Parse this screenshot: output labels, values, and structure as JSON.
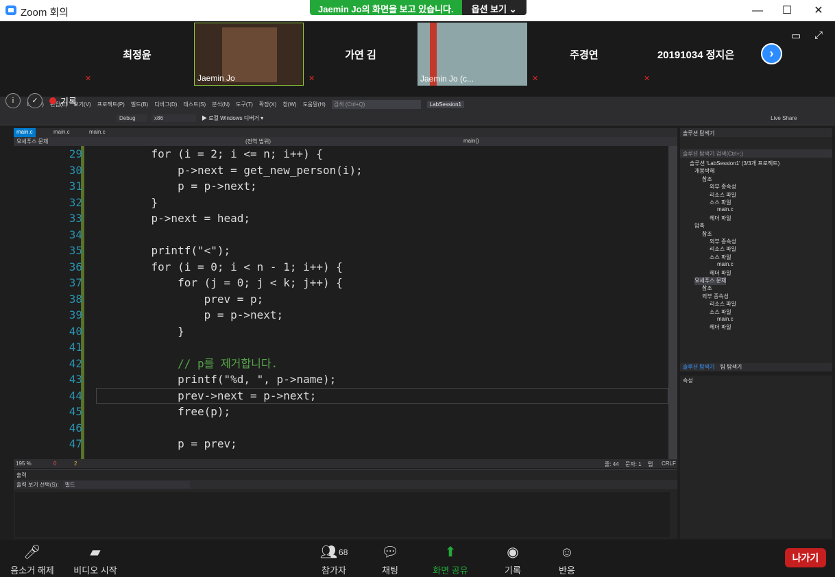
{
  "window": {
    "title": "Zoom 회의",
    "minimize": "—",
    "maximize": "☐",
    "close": "✕"
  },
  "share_banner": {
    "message": "Jaemin Jo의 화면을 보고 있습니다.",
    "options": "옵션 보기 ⌄"
  },
  "gallery": {
    "tiles": [
      {
        "name": "최정윤",
        "video": false
      },
      {
        "name": "Jaemin Jo",
        "video": true
      },
      {
        "name": "가연 김",
        "video": false
      },
      {
        "name": "Jaemin Jo (c...",
        "video": true
      },
      {
        "name": "주경연",
        "video": false
      },
      {
        "name": "20191034 정지은",
        "video": false
      }
    ],
    "next": "›"
  },
  "recording": {
    "label": "기록",
    "info": "i",
    "shield": "✓"
  },
  "vs": {
    "menu": [
      "파일(F)",
      "편집(E)",
      "보기(V)",
      "프로젝트(P)",
      "빌드(B)",
      "디버그(D)",
      "테스트(S)",
      "분석(N)",
      "도구(T)",
      "확장(X)",
      "창(W)",
      "도움말(H)"
    ],
    "search_placeholder": "검색 (Ctrl+Q)",
    "solution_name": "LabSession1",
    "live_share": "Live Share",
    "toolbar": {
      "config": "Debug",
      "platform": "x86",
      "run": "▶ 로컬 Windows 디버거 ▾"
    },
    "tabs": [
      "main.c",
      "main.c",
      "main.c"
    ],
    "nav": {
      "project": "요세푸스 문제",
      "scope": "(전역 범위)",
      "func": "main()"
    },
    "code": [
      {
        "n": "29",
        "t": "    for (i = 2; i <= n; i++) {"
      },
      {
        "n": "30",
        "t": "        p->next = get_new_person(i);"
      },
      {
        "n": "31",
        "t": "        p = p->next;"
      },
      {
        "n": "32",
        "t": "    }"
      },
      {
        "n": "33",
        "t": "    p->next = head;"
      },
      {
        "n": "34",
        "t": ""
      },
      {
        "n": "35",
        "t": "    printf(\"<\");"
      },
      {
        "n": "36",
        "t": "    for (i = 0; i < n - 1; i++) {"
      },
      {
        "n": "37",
        "t": "        for (j = 0; j < k; j++) {"
      },
      {
        "n": "38",
        "t": "            prev = p;"
      },
      {
        "n": "39",
        "t": "            p = p->next;"
      },
      {
        "n": "40",
        "t": "        }"
      },
      {
        "n": "41",
        "t": ""
      },
      {
        "n": "42",
        "t": "        // p를 제거합니다."
      },
      {
        "n": "43",
        "t": "        printf(\"%d, \", p->name);"
      },
      {
        "n": "44",
        "t": "        prev->next = p->next;"
      },
      {
        "n": "45",
        "t": "        free(p);"
      },
      {
        "n": "46",
        "t": ""
      },
      {
        "n": "47",
        "t": "        p = prev;"
      }
    ],
    "status": {
      "zoom": "195 %",
      "errors": "0",
      "warnings": "2",
      "line": "줄: 44",
      "col": "문자: 1",
      "tab": "탭",
      "eol": "CRLF"
    },
    "output": {
      "title": "출력",
      "source_label": "출력 보기 선택(S):",
      "source_value": "빌드"
    },
    "solution_explorer": {
      "title": "솔루션 탐색기",
      "search": "솔루션 탐색기 검색(Ctrl+;)",
      "root": "솔루션 'LabSession1' (3/3개 프로젝트)",
      "items": [
        {
          "label": "개봉박혜",
          "indent": 1
        },
        {
          "label": "참조",
          "indent": 2
        },
        {
          "label": "외부 종속성",
          "indent": 3
        },
        {
          "label": "리소스 파일",
          "indent": 3
        },
        {
          "label": "소스 파일",
          "indent": 3
        },
        {
          "label": "main.c",
          "indent": 4
        },
        {
          "label": "헤더 파일",
          "indent": 3
        },
        {
          "label": "압축",
          "indent": 1
        },
        {
          "label": "참조",
          "indent": 2
        },
        {
          "label": "외부 종속성",
          "indent": 3
        },
        {
          "label": "리소스 파일",
          "indent": 3
        },
        {
          "label": "소스 파일",
          "indent": 3
        },
        {
          "label": "main.c",
          "indent": 4
        },
        {
          "label": "헤더 파일",
          "indent": 3
        },
        {
          "label": "요세푸스 문제",
          "indent": 1
        },
        {
          "label": "참조",
          "indent": 2
        },
        {
          "label": "외부 종속성",
          "indent": 2
        },
        {
          "label": "리소스 파일",
          "indent": 3
        },
        {
          "label": "소스 파일",
          "indent": 3
        },
        {
          "label": "main.c",
          "indent": 4
        },
        {
          "label": "헤더 파일",
          "indent": 3
        }
      ],
      "tabs": [
        "솔루션 탐색기",
        "팀 탐색기"
      ]
    },
    "properties": {
      "title": "속성"
    }
  },
  "bottom": {
    "unmute": "음소거 해제",
    "video": "비디오 시작",
    "participants": "참가자",
    "participants_count": "68",
    "chat": "채팅",
    "share": "화면 공유",
    "record": "기록",
    "reactions": "반응",
    "leave": "나가기"
  }
}
